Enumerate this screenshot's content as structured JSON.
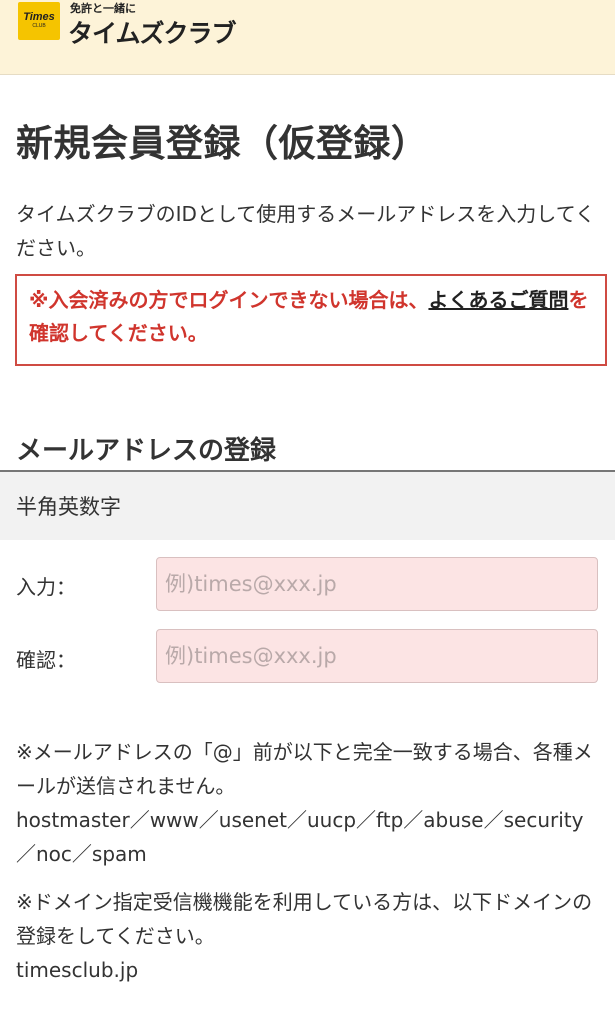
{
  "header": {
    "logo_text": "Times",
    "logo_sub": "CLUB",
    "tagline": "免許と一緒に",
    "brand": "タイムズクラブ"
  },
  "page": {
    "title": "新規会員登録（仮登録）",
    "intro": "タイムズクラブのIDとして使用するメールアドレスを入力してください。"
  },
  "notice": {
    "text_before": "※入会済みの方でログインできない場合は、",
    "link_text": "よくあるご質問",
    "text_after": "を確認してください。"
  },
  "email_section": {
    "heading": "メールアドレスの登録",
    "subheader": "半角英数字",
    "input_label": "入力：",
    "input_placeholder": "例)times@xxx.jp",
    "confirm_label": "確認：",
    "confirm_placeholder": "例)times@xxx.jp"
  },
  "notes": {
    "note1": "※メールアドレスの「@」前が以下と完全一致する場合、各種メールが送信されません。",
    "note1_list": "hostmaster／www／usenet／uucp／ftp／abuse／security／noc／spam",
    "note2": "※ドメイン指定受信機機能を利用している方は、以下ドメインの登録をしてください。",
    "note2_domain": "timesclub.jp"
  }
}
